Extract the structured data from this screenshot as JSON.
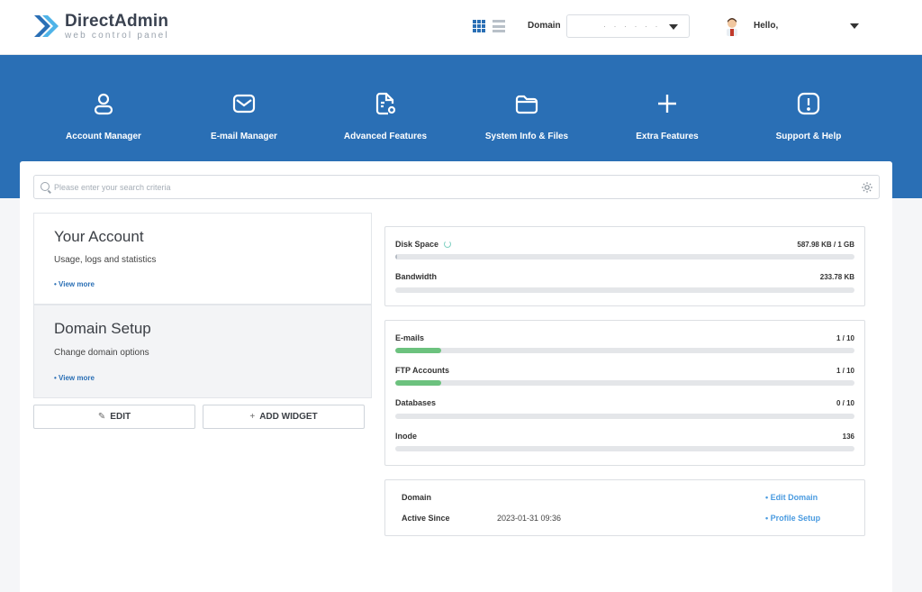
{
  "header": {
    "logo_name": "DirectAdmin",
    "logo_tagline": "web control panel",
    "domain_label": "Domain",
    "domain_value": "· · · · · ·",
    "greeting": "Hello,",
    "brand_color": "#2a6fb5"
  },
  "nav": [
    {
      "label": "Account Manager",
      "icon": "user-icon"
    },
    {
      "label": "E-mail Manager",
      "icon": "envelope-icon"
    },
    {
      "label": "Advanced Features",
      "icon": "document-gear-icon"
    },
    {
      "label": "System Info & Files",
      "icon": "folder-icon"
    },
    {
      "label": "Extra Features",
      "icon": "plus-icon"
    },
    {
      "label": "Support & Help",
      "icon": "exclamation-icon"
    }
  ],
  "search": {
    "placeholder": "Please enter your search criteria"
  },
  "widgets": {
    "account": {
      "title": "Your Account",
      "desc": "Usage, logs and statistics",
      "more": "• View more"
    },
    "domain": {
      "title": "Domain Setup",
      "desc": "Change domain options",
      "more": "• View more"
    },
    "edit_label": "EDIT",
    "add_widget_label": "ADD WIDGET"
  },
  "usage": {
    "disk": {
      "label": "Disk Space",
      "value": "587.98 KB / 1 GB",
      "fraction": 0.001
    },
    "bandwidth": {
      "label": "Bandwidth",
      "value": "233.78 KB",
      "fraction": 0
    }
  },
  "counts": [
    {
      "label": "E-mails",
      "value": "1 / 10",
      "fraction": 0.1
    },
    {
      "label": "FTP Accounts",
      "value": "1 / 10",
      "fraction": 0.1
    },
    {
      "label": "Databases",
      "value": "0 / 10",
      "fraction": 0
    },
    {
      "label": "Inode",
      "value": "136",
      "fraction": 0
    }
  ],
  "info": {
    "domain_label": "Domain",
    "domain_value": "",
    "active_label": "Active Since",
    "active_value": "2023-01-31 09:36",
    "edit_domain": "• Edit Domain",
    "profile_setup": "• Profile Setup"
  }
}
